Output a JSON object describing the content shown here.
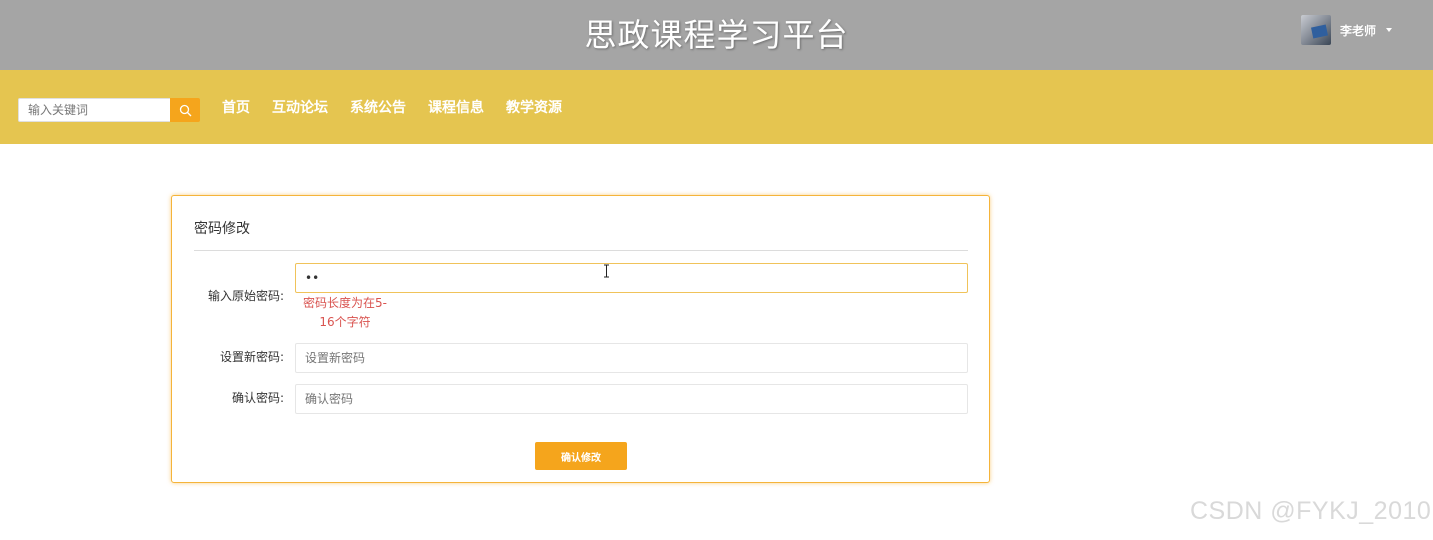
{
  "header": {
    "title": "思政课程学习平台",
    "user_name": "李老师"
  },
  "navbar": {
    "search": {
      "placeholder": "输入关键词",
      "icon": "search-icon"
    },
    "items": [
      {
        "label": "首页"
      },
      {
        "label": "互动论坛"
      },
      {
        "label": "系统公告"
      },
      {
        "label": "课程信息"
      },
      {
        "label": "教学资源"
      }
    ]
  },
  "form": {
    "title": "密码修改",
    "fields": [
      {
        "label": "输入原始密码:",
        "value": "••",
        "placeholder": ""
      },
      {
        "label": "设置新密码:",
        "value": "",
        "placeholder": "设置新密码"
      },
      {
        "label": "确认密码:",
        "value": "",
        "placeholder": "确认密码"
      }
    ],
    "error": "密码长度为在5-16个字符",
    "submit_label": "确认修改"
  },
  "watermark": "CSDN @FYKJ_2010",
  "colors": {
    "header_bg": "#a5a5a5",
    "navbar_bg": "#e5c550",
    "accent": "#f5a51c",
    "error": "#d9534f"
  }
}
